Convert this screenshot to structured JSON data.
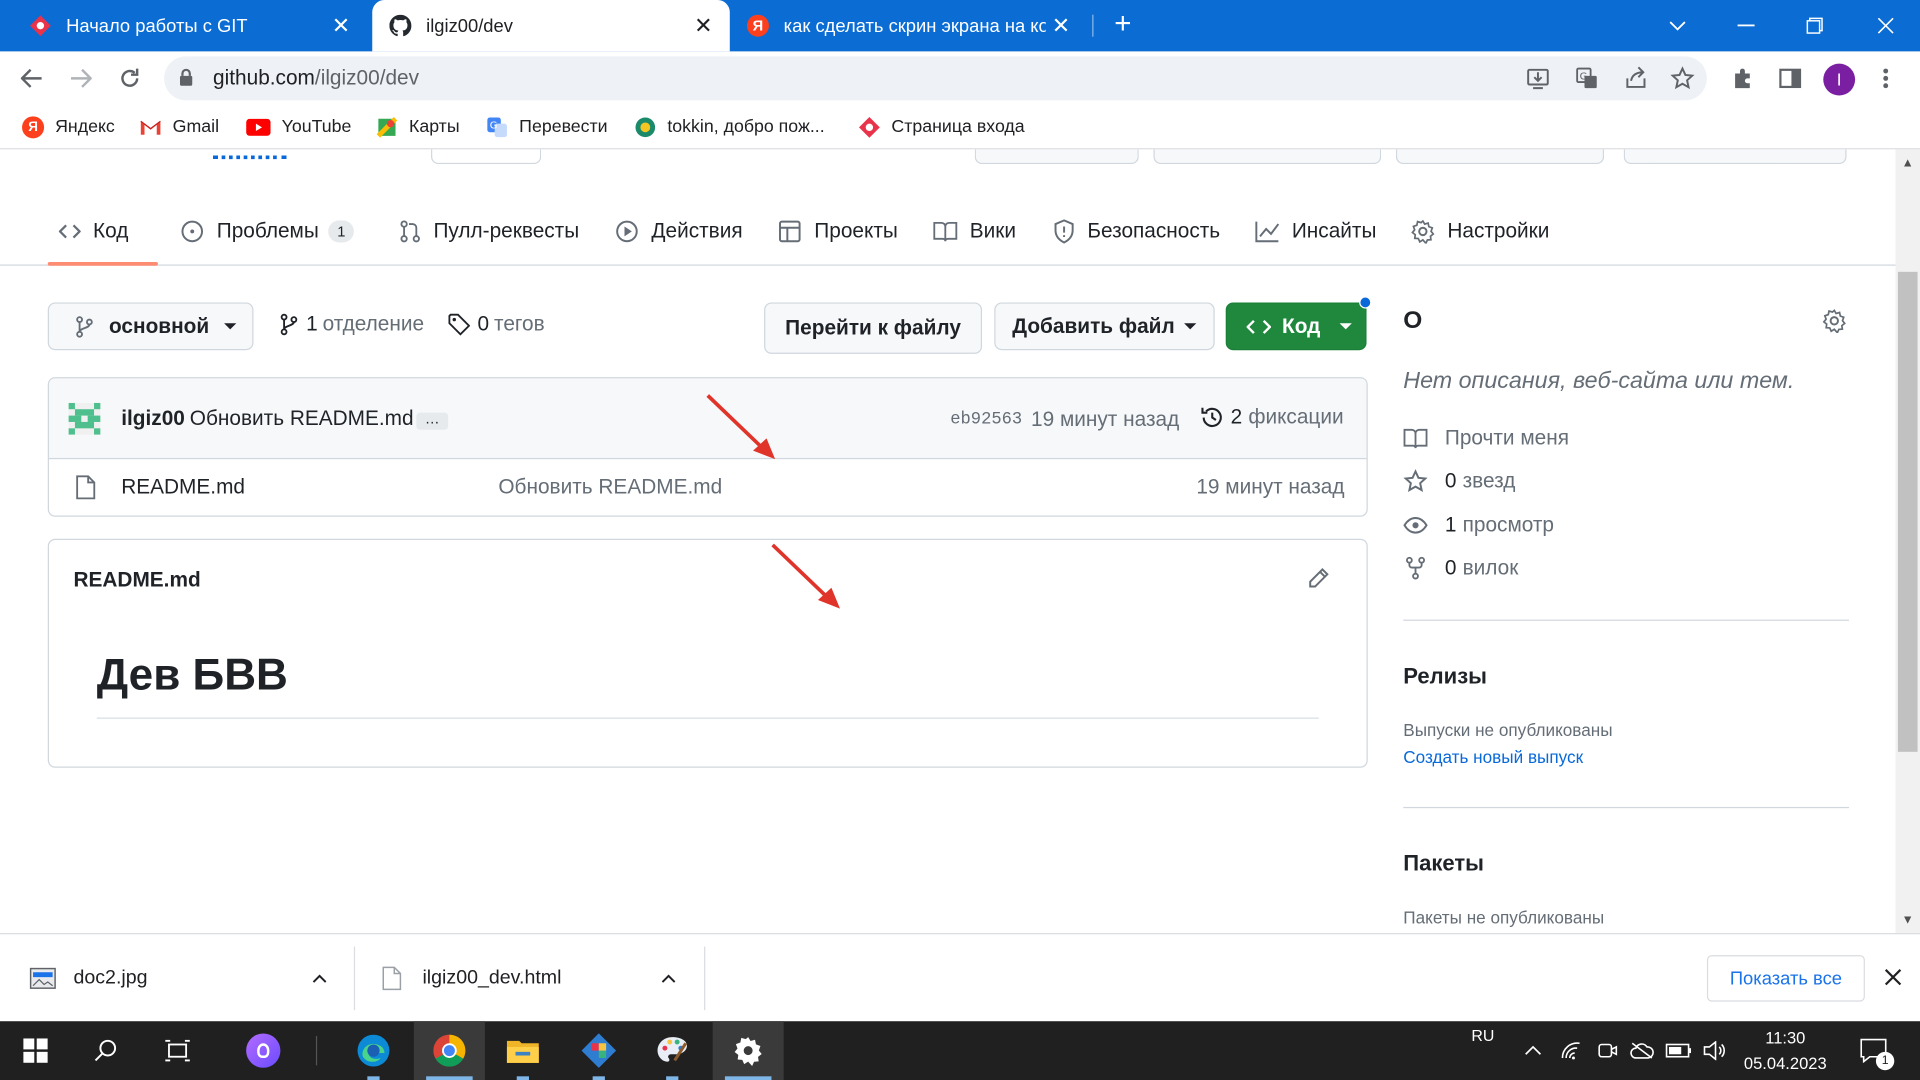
{
  "browser": {
    "tabs": [
      {
        "title": "Начало работы с GIT",
        "close": "✕"
      },
      {
        "title": "ilgiz00/dev",
        "close": "✕"
      },
      {
        "title": "как сделать скрин экрана на ко...",
        "close": "✕"
      }
    ],
    "new_tab": "+",
    "url_host": "github.com",
    "url_path": "/ilgiz00/dev",
    "profile_initial": "I"
  },
  "bookmarks": [
    {
      "label": "Яндекс",
      "icon": "yandex-icon"
    },
    {
      "label": "Gmail",
      "icon": "gmail-icon"
    },
    {
      "label": "YouTube",
      "icon": "youtube-icon"
    },
    {
      "label": "Карты",
      "icon": "maps-icon"
    },
    {
      "label": "Перевести",
      "icon": "translate-icon"
    },
    {
      "label": "tokkin, добро пож...",
      "icon": "globe-icon"
    },
    {
      "label": "Страница входа",
      "icon": "diamond-icon"
    }
  ],
  "repo_nav": [
    {
      "label": "Код",
      "icon": "code-icon"
    },
    {
      "label": "Проблемы",
      "icon": "issue-icon",
      "count": "1"
    },
    {
      "label": "Пулл-реквесты",
      "icon": "pull-request-icon"
    },
    {
      "label": "Действия",
      "icon": "play-icon"
    },
    {
      "label": "Проекты",
      "icon": "table-icon"
    },
    {
      "label": "Вики",
      "icon": "book-icon"
    },
    {
      "label": "Безопасность",
      "icon": "shield-icon"
    },
    {
      "label": "Инсайты",
      "icon": "graph-icon"
    },
    {
      "label": "Настройки",
      "icon": "gear-icon"
    }
  ],
  "toolbar": {
    "branch": "основной",
    "branches_count": "1",
    "branches_label": "отделение",
    "tags_count": "0",
    "tags_label": "тегов",
    "goto_file": "Перейти к файлу",
    "add_file": "Добавить файл",
    "code": "Код"
  },
  "commit": {
    "author": "ilgiz00",
    "message": "Обновить README.md",
    "ellipsis": "…",
    "sha": "eb92563",
    "time": "19 минут назад",
    "commits_count": "2",
    "commits_label": "фиксации"
  },
  "files": [
    {
      "name": "README.md",
      "message": "Обновить README.md",
      "time": "19 минут назад"
    }
  ],
  "readme": {
    "filename": "README.md",
    "heading": "Дев БВВ"
  },
  "about": {
    "title": "О",
    "description": "Нет описания, веб-сайта или тем.",
    "readme_link": "Прочти меня",
    "stars_count": "0",
    "stars_label": "звезд",
    "watch_count": "1",
    "watch_label": "просмотр",
    "forks_count": "0",
    "forks_label": "вилок"
  },
  "releases": {
    "title": "Релизы",
    "empty": "Выпуски не опубликованы",
    "create": "Создать новый выпуск"
  },
  "packages": {
    "title": "Пакеты",
    "empty": "Пакеты не опубликованы"
  },
  "downloads": {
    "items": [
      {
        "name": "doc2.jpg",
        "icon": "image-file-icon"
      },
      {
        "name": "ilgiz00_dev.html",
        "icon": "html-file-icon"
      }
    ],
    "show_all": "Показать все"
  },
  "taskbar": {
    "lang": "RU",
    "time": "11:30",
    "date": "05.04.2023",
    "notif_count": "1"
  },
  "colors": {
    "chrome_tabbar": "#0b6cd3",
    "github_green": "#1f883d",
    "link": "#0969da",
    "nav_underline": "#fd8c73",
    "arrow_annotation": "#e0342a"
  }
}
